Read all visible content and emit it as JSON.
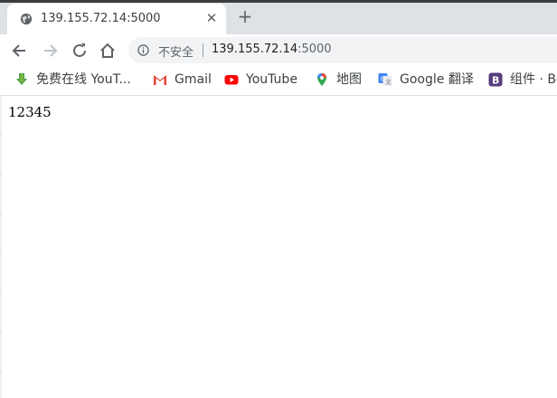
{
  "browser": {
    "tab": {
      "title": "139.155.72.14:5000",
      "icon": "globe-icon"
    },
    "new_tab_symbol": "+",
    "omnibox": {
      "security_label": "不安全",
      "url_host": "139.155.72.14",
      "url_port": ":5000"
    },
    "bookmarks": [
      {
        "label": "免费在线 YouT...",
        "icon": "download-arrow-icon"
      },
      {
        "label": "Gmail",
        "icon": "gmail-icon"
      },
      {
        "label": "YouTube",
        "icon": "youtube-icon"
      },
      {
        "label": "地图",
        "icon": "maps-pin-icon"
      },
      {
        "label": "Google 翻译",
        "icon": "translate-icon"
      },
      {
        "label": "组件 · Bo",
        "icon": "bootstrap-icon"
      }
    ]
  },
  "page": {
    "body_text": "12345"
  },
  "colors": {
    "tabstrip": "#dee1e6",
    "omnibox": "#f1f3f4",
    "accent_youtube": "#ff0000",
    "accent_bootstrap": "#563d7c"
  }
}
